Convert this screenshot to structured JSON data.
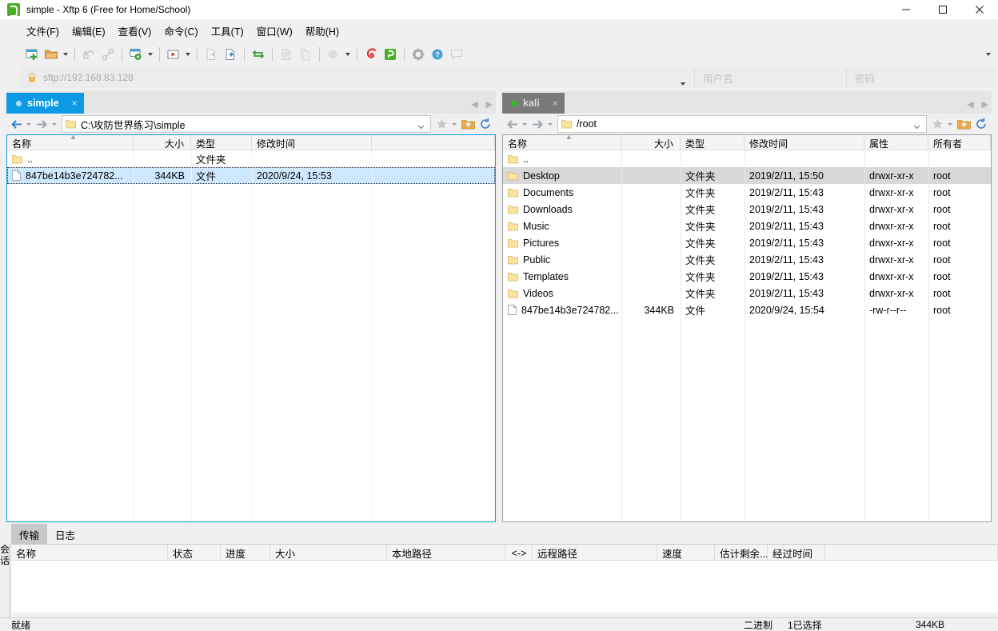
{
  "window": {
    "title": "simple - Xftp 6 (Free for Home/School)",
    "app_icon": "xftp-logo-icon",
    "controls": {
      "minimize": "—",
      "maximize": "▢",
      "close": "✕"
    }
  },
  "menu": {
    "items": [
      {
        "label": "文件(F)",
        "name": "menu-file"
      },
      {
        "label": "编辑(E)",
        "name": "menu-edit"
      },
      {
        "label": "查看(V)",
        "name": "menu-view"
      },
      {
        "label": "命令(C)",
        "name": "menu-command"
      },
      {
        "label": "工具(T)",
        "name": "menu-tools"
      },
      {
        "label": "窗口(W)",
        "name": "menu-window"
      },
      {
        "label": "帮助(H)",
        "name": "menu-help"
      }
    ]
  },
  "toolbar": {
    "icons": [
      "new-session-icon",
      "open-folder-icon",
      "reconnect-all-icon",
      "disconnect-icon",
      "session-properties-icon",
      "run-script-icon",
      "copy-file-icon",
      "paste-file-icon",
      "sync-browsing-icon",
      "compare-icon",
      "duplicate-icon",
      "transfer-mode-icon",
      "xshell-icon",
      "xftp-icon",
      "options-gear-icon",
      "help-icon",
      "feedback-icon"
    ]
  },
  "connection": {
    "url": "sftp://192.168.83.128",
    "lock_icon": "lock-icon",
    "username_placeholder": "用户名",
    "password_placeholder": "密码"
  },
  "left_pane": {
    "tab": {
      "label": "simple",
      "close": "×",
      "status_dot": "#b7dcf5",
      "active": true
    },
    "path": "C:\\攻防世界练习\\simple",
    "columns": [
      "名称",
      "大小",
      "类型",
      "修改时间"
    ],
    "rows": [
      {
        "icon": "folder-icon",
        "name": "..",
        "size": "",
        "type": "文件夹",
        "modified": "",
        "selected": false
      },
      {
        "icon": "file-icon",
        "name": "847be14b3e724782...",
        "size": "344KB",
        "type": "文件",
        "modified": "2020/9/24, 15:53",
        "selected": true
      }
    ]
  },
  "right_pane": {
    "tab": {
      "label": "kali",
      "close": "×",
      "status_dot": "#22c422",
      "active": false
    },
    "path": "/root",
    "columns": [
      "名称",
      "大小",
      "类型",
      "修改时间",
      "属性",
      "所有者"
    ],
    "rows": [
      {
        "icon": "folder-icon",
        "name": "..",
        "size": "",
        "type": "",
        "modified": "",
        "attr": "",
        "owner": "",
        "hovered": false
      },
      {
        "icon": "folder-icon",
        "name": "Desktop",
        "size": "",
        "type": "文件夹",
        "modified": "2019/2/11, 15:50",
        "attr": "drwxr-xr-x",
        "owner": "root",
        "hovered": true
      },
      {
        "icon": "folder-icon",
        "name": "Documents",
        "size": "",
        "type": "文件夹",
        "modified": "2019/2/11, 15:43",
        "attr": "drwxr-xr-x",
        "owner": "root",
        "hovered": false
      },
      {
        "icon": "folder-icon",
        "name": "Downloads",
        "size": "",
        "type": "文件夹",
        "modified": "2019/2/11, 15:43",
        "attr": "drwxr-xr-x",
        "owner": "root",
        "hovered": false
      },
      {
        "icon": "folder-icon",
        "name": "Music",
        "size": "",
        "type": "文件夹",
        "modified": "2019/2/11, 15:43",
        "attr": "drwxr-xr-x",
        "owner": "root",
        "hovered": false
      },
      {
        "icon": "folder-icon",
        "name": "Pictures",
        "size": "",
        "type": "文件夹",
        "modified": "2019/2/11, 15:43",
        "attr": "drwxr-xr-x",
        "owner": "root",
        "hovered": false
      },
      {
        "icon": "folder-icon",
        "name": "Public",
        "size": "",
        "type": "文件夹",
        "modified": "2019/2/11, 15:43",
        "attr": "drwxr-xr-x",
        "owner": "root",
        "hovered": false
      },
      {
        "icon": "folder-icon",
        "name": "Templates",
        "size": "",
        "type": "文件夹",
        "modified": "2019/2/11, 15:43",
        "attr": "drwxr-xr-x",
        "owner": "root",
        "hovered": false
      },
      {
        "icon": "folder-icon",
        "name": "Videos",
        "size": "",
        "type": "文件夹",
        "modified": "2019/2/11, 15:43",
        "attr": "drwxr-xr-x",
        "owner": "root",
        "hovered": false
      },
      {
        "icon": "file-icon",
        "name": "847be14b3e724782...",
        "size": "344KB",
        "type": "文件",
        "modified": "2020/9/24, 15:54",
        "attr": "-rw-r--r--",
        "owner": "root",
        "hovered": false
      }
    ]
  },
  "bottom": {
    "tabs": [
      {
        "label": "传输",
        "active": true
      },
      {
        "label": "日志",
        "active": false
      }
    ],
    "columns": [
      "名称",
      "状态",
      "进度",
      "大小",
      "本地路径",
      "<->",
      "远程路径",
      "速度",
      "估计剩余...",
      "经过时间"
    ],
    "side_tab": "会话"
  },
  "status": {
    "ready": "就绪",
    "mode": "二进制",
    "selection": "1已选择",
    "size": "344KB"
  },
  "colors": {
    "accent": "#0d9ae5",
    "tab_inactive": "#7a7a7a",
    "selection": "#cde8ff",
    "hover": "#d8d8d8",
    "folder": "#f5d27a",
    "window_bg": "#f0f0f0"
  }
}
